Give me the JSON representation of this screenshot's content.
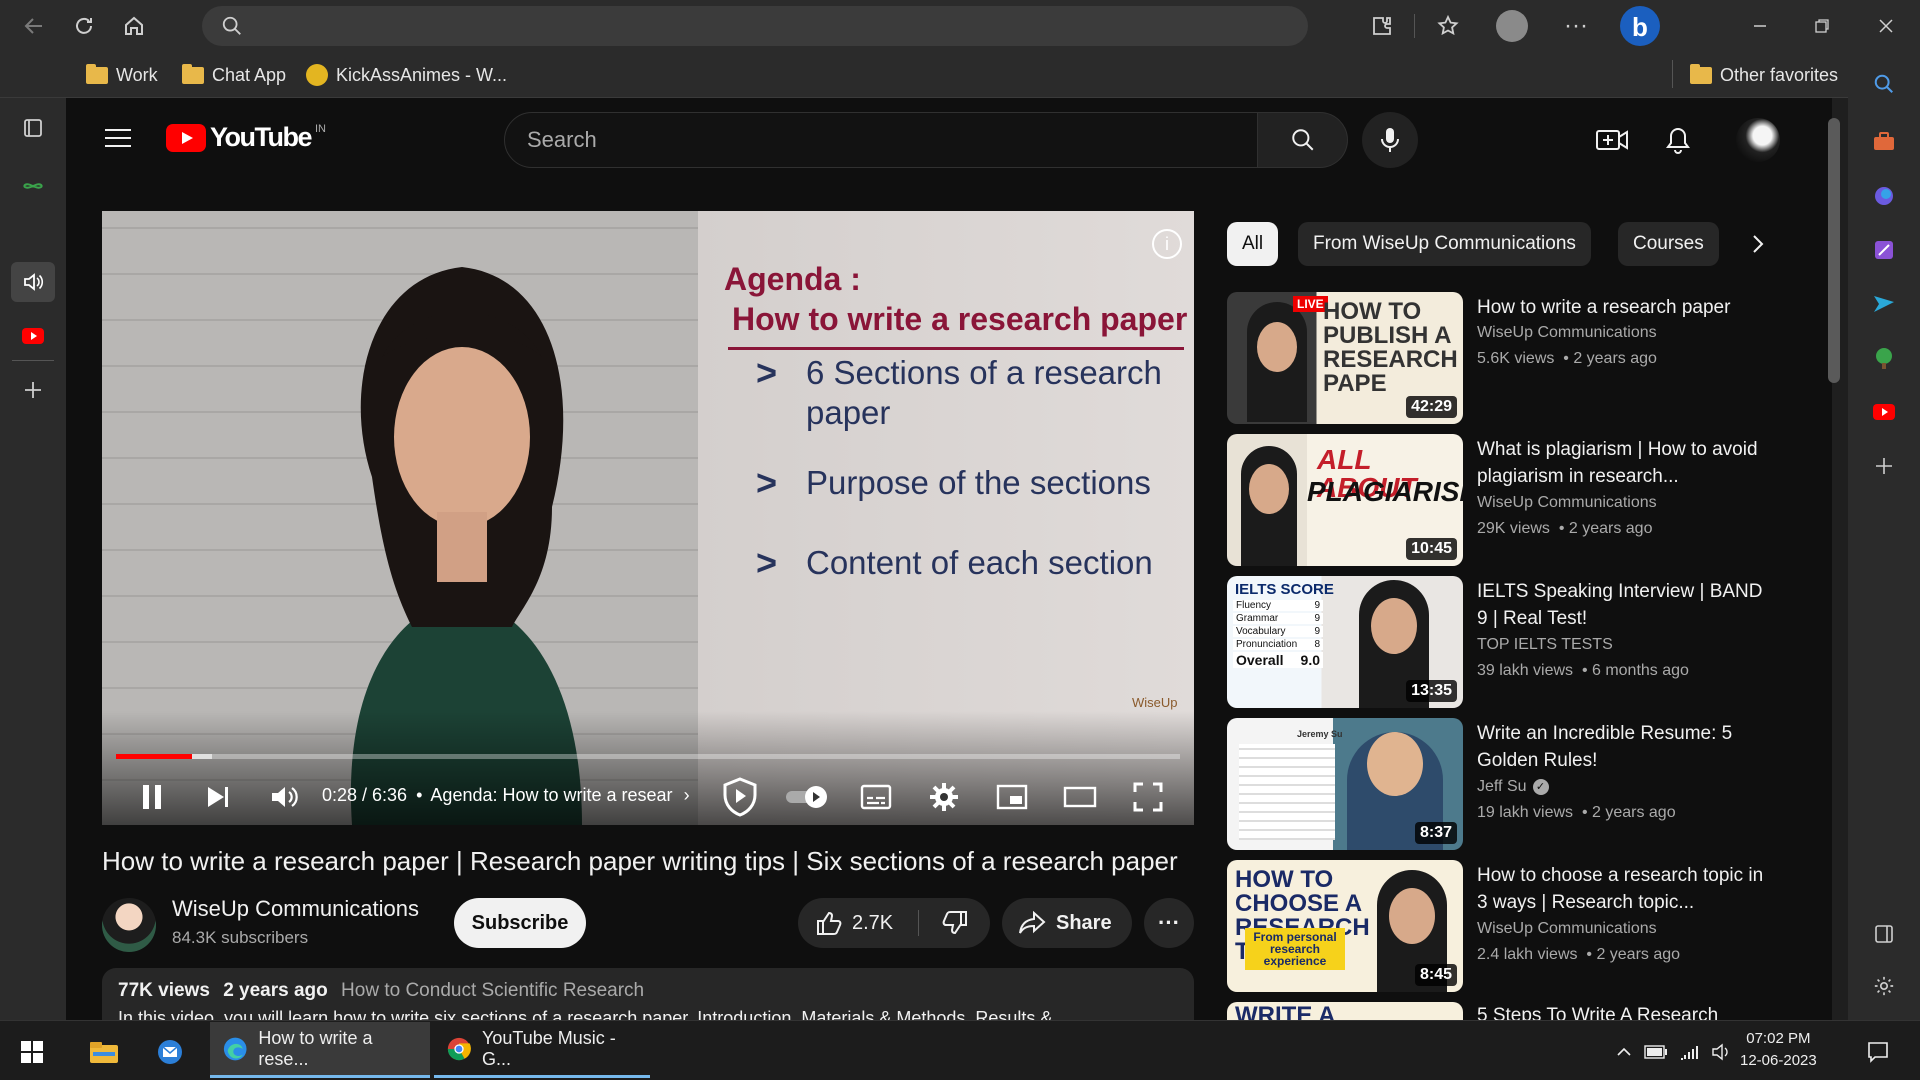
{
  "browser": {
    "address_text": "",
    "bookmarks": [
      {
        "label": "Work"
      },
      {
        "label": "Chat App"
      },
      {
        "label": "KickAssAnimes - W..."
      }
    ],
    "other_favorites": "Other favorites"
  },
  "youtube": {
    "logo_text": "YouTube",
    "region": "IN",
    "search_placeholder": "Search"
  },
  "player": {
    "slide": {
      "heading": "Agenda :",
      "subheading": "How to write a research paper",
      "items": [
        "6 Sections of a research paper",
        "Purpose of the sections",
        "Content of each section"
      ],
      "watermark": "WiseUp"
    },
    "time": "0:28 / 6:36",
    "chapter": "Agenda: How to write a resear",
    "progress_fraction": 0.071
  },
  "video": {
    "title": "How to write a research paper | Research paper writing tips | Six sections of a research paper",
    "channel": "WiseUp Communications",
    "subscribers": "84.3K subscribers",
    "subscribe_label": "Subscribe",
    "likes": "2.7K",
    "share_label": "Share",
    "views": "77K views",
    "age": "2 years ago",
    "playlist": "How to Conduct Scientific Research",
    "description_start": "In this video, you will learn how to write six sections of a research paper, Introduction, Materials & Methods, Results &"
  },
  "chips": [
    "All",
    "From WiseUp Communications",
    "Courses"
  ],
  "recommendations": [
    {
      "title": "How to write a research paper",
      "channel": "WiseUp Communications",
      "views": "5.6K views",
      "age": "2 years ago",
      "duration": "42:29",
      "thumb_text": "HOW TO PUBLISH A RESEARCH PAPE",
      "badge": "LIVE"
    },
    {
      "title": "What is plagiarism | How to avoid plagiarism in research...",
      "channel": "WiseUp Communications",
      "views": "29K views",
      "age": "2 years ago",
      "duration": "10:45",
      "thumb_text_1": "ALL ABOUT",
      "thumb_text_2": "PLAGIARISM"
    },
    {
      "title": "IELTS Speaking Interview | BAND 9 | Real Test!",
      "channel": "TOP IELTS TESTS",
      "views": "39 lakh views",
      "age": "6 months ago",
      "duration": "13:35",
      "thumb_text": "IELTS SCORE",
      "scores": [
        [
          "Fluency",
          "9"
        ],
        [
          "Grammar",
          "9"
        ],
        [
          "Vocabulary",
          "9"
        ],
        [
          "Pronunciation",
          "8"
        ],
        [
          "Overall",
          "9.0"
        ]
      ]
    },
    {
      "title": "Write an Incredible Resume: 5 Golden Rules!",
      "channel": "Jeff Su",
      "views": "19 lakh views",
      "age": "2 years ago",
      "duration": "8:37",
      "thumb_text": "Jeremy Su"
    },
    {
      "title": "How to choose a research topic in 3 ways | Research topic...",
      "channel": "WiseUp Communications",
      "views": "2.4 lakh views",
      "age": "2 years ago",
      "duration": "8:45",
      "thumb_text": "HOW TO CHOOSE A RESEARCH TOPIC",
      "thumb_sub": "From personal research experience"
    },
    {
      "title": "5 Steps To Write A Research",
      "thumb_text": "WRITE A"
    }
  ],
  "taskbar": {
    "apps": [
      {
        "label": "How to write a rese..."
      },
      {
        "label": "YouTube Music - G..."
      }
    ],
    "time": "07:02 PM",
    "date": "12-06-2023"
  },
  "colors": {
    "accent_red": "#ff0000",
    "slide_title": "#8a1538",
    "slide_text": "#27335c"
  }
}
